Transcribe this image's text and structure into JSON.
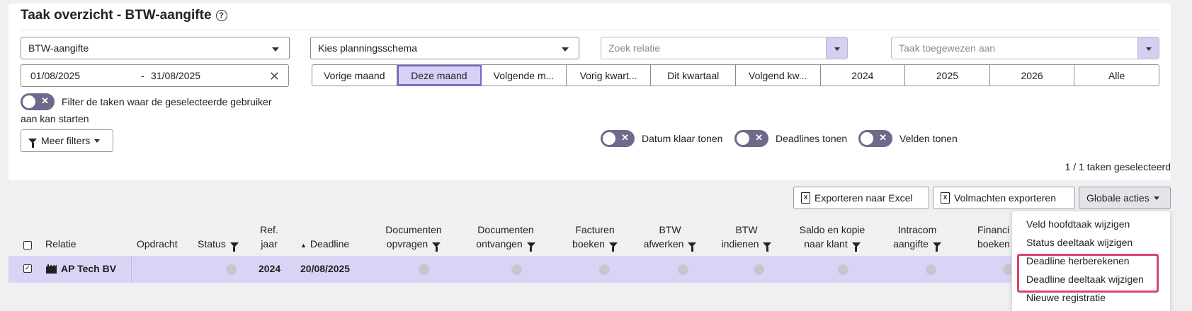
{
  "header": {
    "title": "Taak overzicht - BTW-aangifte",
    "help_icon": "?"
  },
  "filters": {
    "type_select": "BTW-aangifte",
    "schema_select": "Kies planningsschema",
    "relation_placeholder": "Zoek relatie",
    "assigned_placeholder": "Taak toegewezen aan",
    "date_from": "01/08/2025",
    "date_sep": "-",
    "date_to": "31/08/2025",
    "periods": [
      "Vorige maand",
      "Deze maand",
      "Volgende m...",
      "Vorig kwart...",
      "Dit kwartaal",
      "Volgend kw...",
      "2024",
      "2025",
      "2026",
      "Alle"
    ],
    "active_period": "Deze maand",
    "user_filter_label_1": "Filter de taken waar de geselecteerde gebruiker",
    "user_filter_label_2": "aan kan starten",
    "more_filters": "Meer filters",
    "toggles": {
      "date_ready": "Datum klaar tonen",
      "deadlines": "Deadlines tonen",
      "fields": "Velden tonen"
    },
    "selected_count": "1 / 1 taken geselecteerd"
  },
  "toolbar": {
    "export_excel": "Exporteren naar Excel",
    "export_mandates": "Volmachten exporteren",
    "global_actions": "Globale acties"
  },
  "table": {
    "headers": {
      "relatie": "Relatie",
      "opdracht": "Opdracht",
      "status": "Status",
      "refjaar_1": "Ref.",
      "refjaar_2": "jaar",
      "deadline": "Deadline",
      "doc_opvragen_1": "Documenten",
      "doc_opvragen_2": "opvragen",
      "doc_ontvangen_1": "Documenten",
      "doc_ontvangen_2": "ontvangen",
      "facturen_1": "Facturen",
      "facturen_2": "boeken",
      "btw_afwerken_1": "BTW",
      "btw_afwerken_2": "afwerken",
      "btw_indienen_1": "BTW",
      "btw_indienen_2": "indienen",
      "saldo_1": "Saldo en kopie",
      "saldo_2": "naar klant",
      "intracom_1": "Intracom",
      "intracom_2": "aangifte",
      "financ_1": "Financi",
      "financ_2": "boeken"
    },
    "rows": [
      {
        "relatie": "AP Tech BV",
        "ref_jaar": "2024",
        "deadline": "20/08/2025",
        "checked": true
      }
    ]
  },
  "global_actions_menu": {
    "items": [
      "Veld hoofdtaak wijzigen",
      "Status deeltaak wijzigen",
      "Deadline herberekenen",
      "Deadline deeltaak wijzigen",
      "Nieuwe registratie"
    ]
  }
}
